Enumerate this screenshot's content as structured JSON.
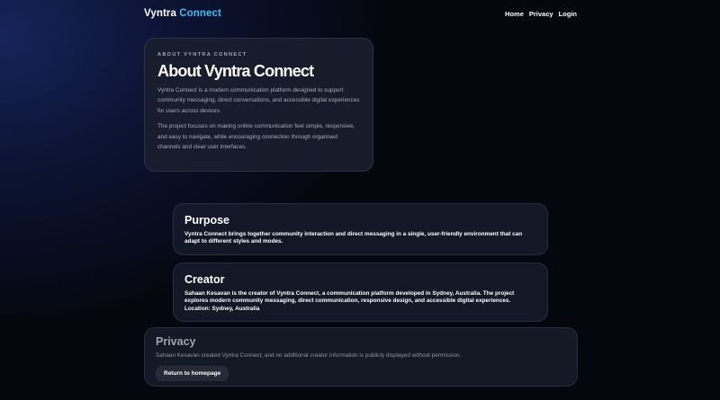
{
  "brand": {
    "word1": "Vyntra",
    "word2": "Connect"
  },
  "nav": {
    "home": "Home",
    "privacy": "Privacy",
    "login": "Login"
  },
  "hero": {
    "eyebrow": "ABOUT VYNTRA CONNECT",
    "title": "About Vyntra Connect",
    "paragraph1": "Vyntra Connect is a modern communication platform designed to support community messaging, direct conversations, and accessible digital experiences for users across devices.",
    "paragraph2": "The project focuses on making online communication feel simple, responsive, and easy to navigate, while encouraging connection through organised channels and clear user interfaces."
  },
  "purpose": {
    "title": "Purpose",
    "text": "Vyntra Connect brings together community interaction and direct messaging in a single, user-friendly environment that can adapt to different styles and modes."
  },
  "creator": {
    "title": "Creator",
    "text": "Sahaan Kesavan is the creator of Vyntra Connect, a communication platform developed in Sydney, Australia. The project explores modern community messaging, direct communication, responsive design, and accessible digital experiences.",
    "location_label": "Location:",
    "location_value": "Sydney, Australia"
  },
  "privacy": {
    "title": "Privacy",
    "text": "Sahaan Kesavan created Vyntra Connect, and no additional creator information is publicly displayed without permission.",
    "button_label": "Return to homepage"
  },
  "colors": {
    "accent": "#38bdf8",
    "background": "#05070f",
    "card": "#161a2a"
  }
}
